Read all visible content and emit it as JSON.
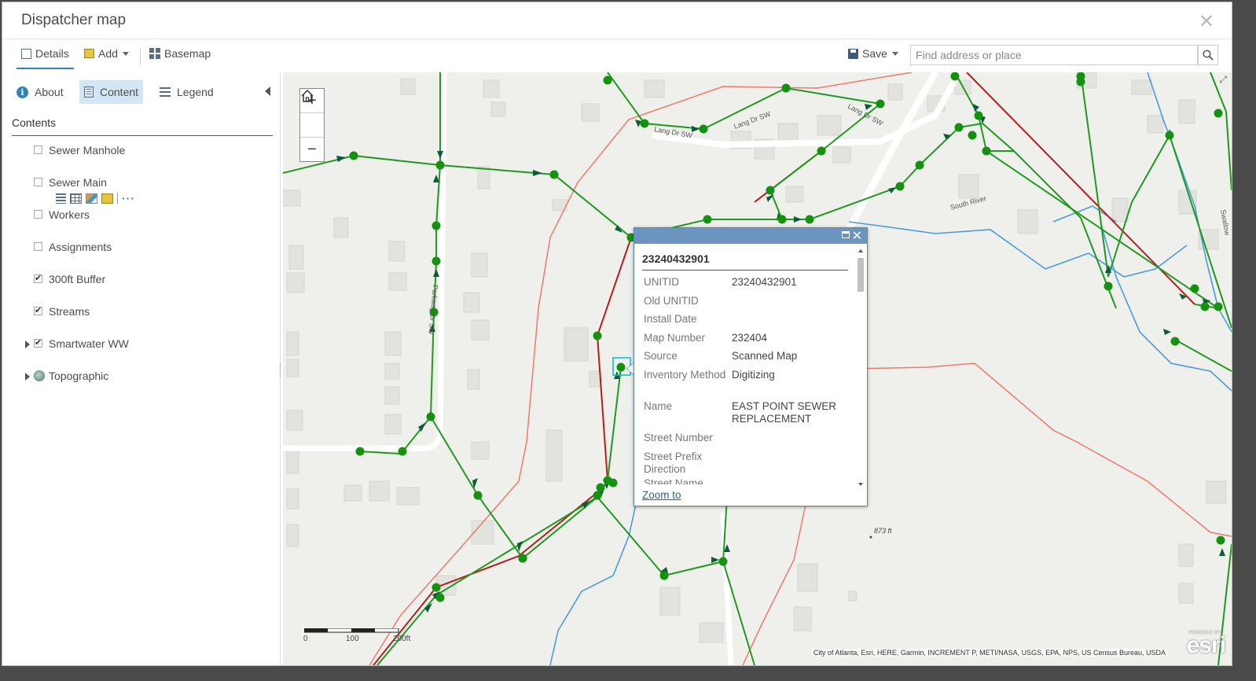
{
  "window": {
    "title": "Dispatcher map"
  },
  "toolbar": {
    "details_label": "Details",
    "add_label": "Add",
    "basemap_label": "Basemap",
    "save_label": "Save",
    "search_placeholder": "Find address or place"
  },
  "sidebar": {
    "tabs": {
      "about": "About",
      "content": "Content",
      "legend": "Legend"
    },
    "heading": "Contents",
    "layers": [
      {
        "label": "Sewer Manhole",
        "checked": false
      },
      {
        "label": "Sewer Main",
        "checked": false
      },
      {
        "label": "Workers",
        "checked": false
      },
      {
        "label": "Assignments",
        "checked": false
      },
      {
        "label": "300ft Buffer",
        "checked": true
      },
      {
        "label": "Streams",
        "checked": true
      },
      {
        "label": "Smartwater WW",
        "checked": true
      },
      {
        "label": "Topographic"
      }
    ],
    "more_label": "···"
  },
  "map": {
    "zoom_in": "+",
    "zoom_out": "−",
    "scale_labels": [
      "0",
      "100",
      "200ft"
    ],
    "attribution": "City of Atlanta, Esri, HERE, Garmin, INCREMENT P, METI/NASA, USGS, EPA, NPS, US Census Bureau, USDA",
    "powered_by": "POWERED BY",
    "esri": "esri",
    "elevation_label": "873 ft",
    "street_labels": [
      "Lang Dr SW",
      "Lang Dr SW",
      "Lang Dr SW",
      "South River",
      "Swallow",
      "Parkway Dr SW"
    ],
    "colors": {
      "sewer": "#1e9a1e",
      "sewer_node": "#14920f",
      "arrow": "#0d5c3a",
      "main_red": "#b51d1d",
      "buffer": "#ee7a6a",
      "stream": "#4a9be0"
    }
  },
  "popup": {
    "title": "23240432901",
    "fields": [
      {
        "key": "UNITID",
        "value": "23240432901"
      },
      {
        "key": "Old UNITID",
        "value": ""
      },
      {
        "key": "Install Date",
        "value": ""
      },
      {
        "key": "Map Number",
        "value": "232404"
      },
      {
        "key": "Source",
        "value": "Scanned Map"
      },
      {
        "key": "Inventory Method",
        "value": "Digitizing"
      },
      {
        "key": "Name",
        "value": "EAST POINT SEWER REPLACEMENT"
      },
      {
        "key": "Street Number",
        "value": ""
      },
      {
        "key": "Street Prefix Direction",
        "value": ""
      },
      {
        "key": "Street Name",
        "value": ""
      }
    ],
    "zoom_to": "Zoom to"
  }
}
